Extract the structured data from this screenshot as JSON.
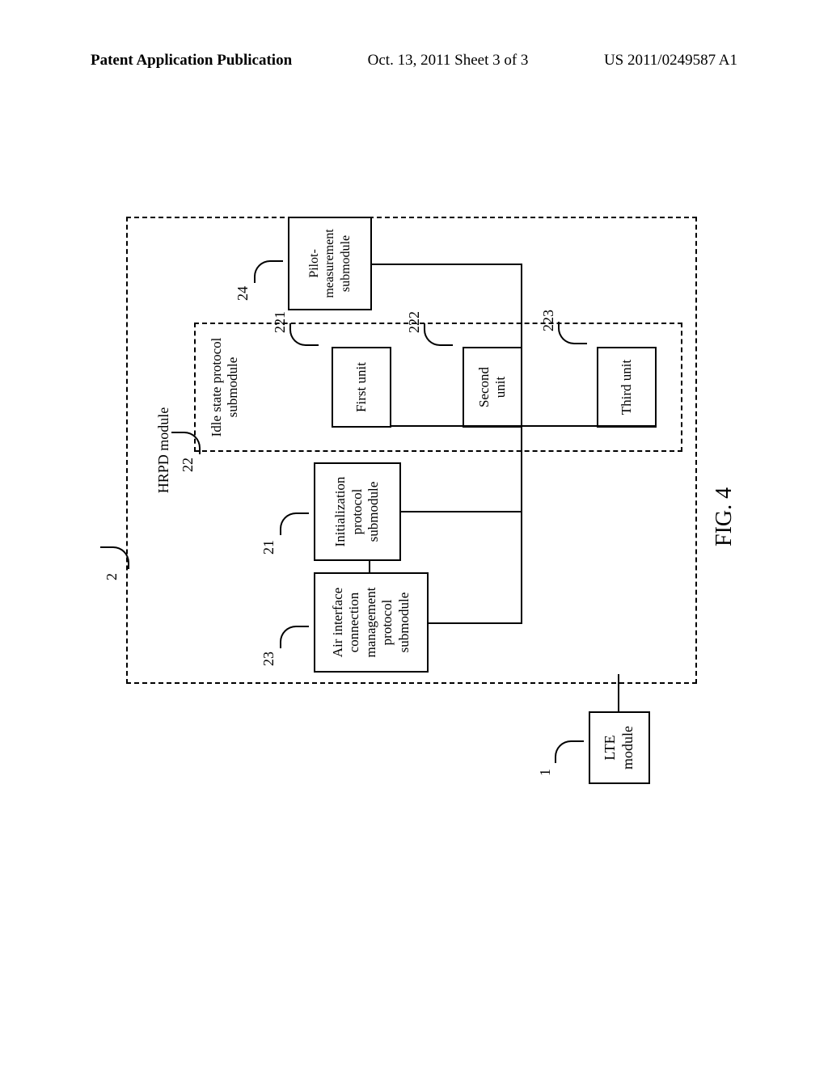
{
  "header": {
    "left": "Patent Application Publication",
    "middle": "Oct. 13, 2011  Sheet 3 of 3",
    "right": "US 2011/0249587 A1"
  },
  "lte": {
    "line1": "LTE",
    "line2": "module"
  },
  "hrpd": {
    "title": "HRPD module"
  },
  "air": {
    "l1": "Air interface",
    "l2": "connection",
    "l3": "management",
    "l4": "protocol",
    "l5": "submodule"
  },
  "init": {
    "l1": "Initialization",
    "l2": "protocol",
    "l3": "submodule"
  },
  "idle": {
    "l1": "Idle state protocol",
    "l2": "submodule"
  },
  "units": {
    "first": "First unit",
    "second_l1": "Second",
    "second_l2": "unit",
    "third": "Third unit"
  },
  "pilot": {
    "l1": "Pilot-",
    "l2": "measurement",
    "l3": "submodule"
  },
  "refs": {
    "r1": "1",
    "r2": "2",
    "r21": "21",
    "r22": "22",
    "r23": "23",
    "r24": "24",
    "r221": "221",
    "r222": "222",
    "r223": "223"
  },
  "figure": "FIG. 4"
}
